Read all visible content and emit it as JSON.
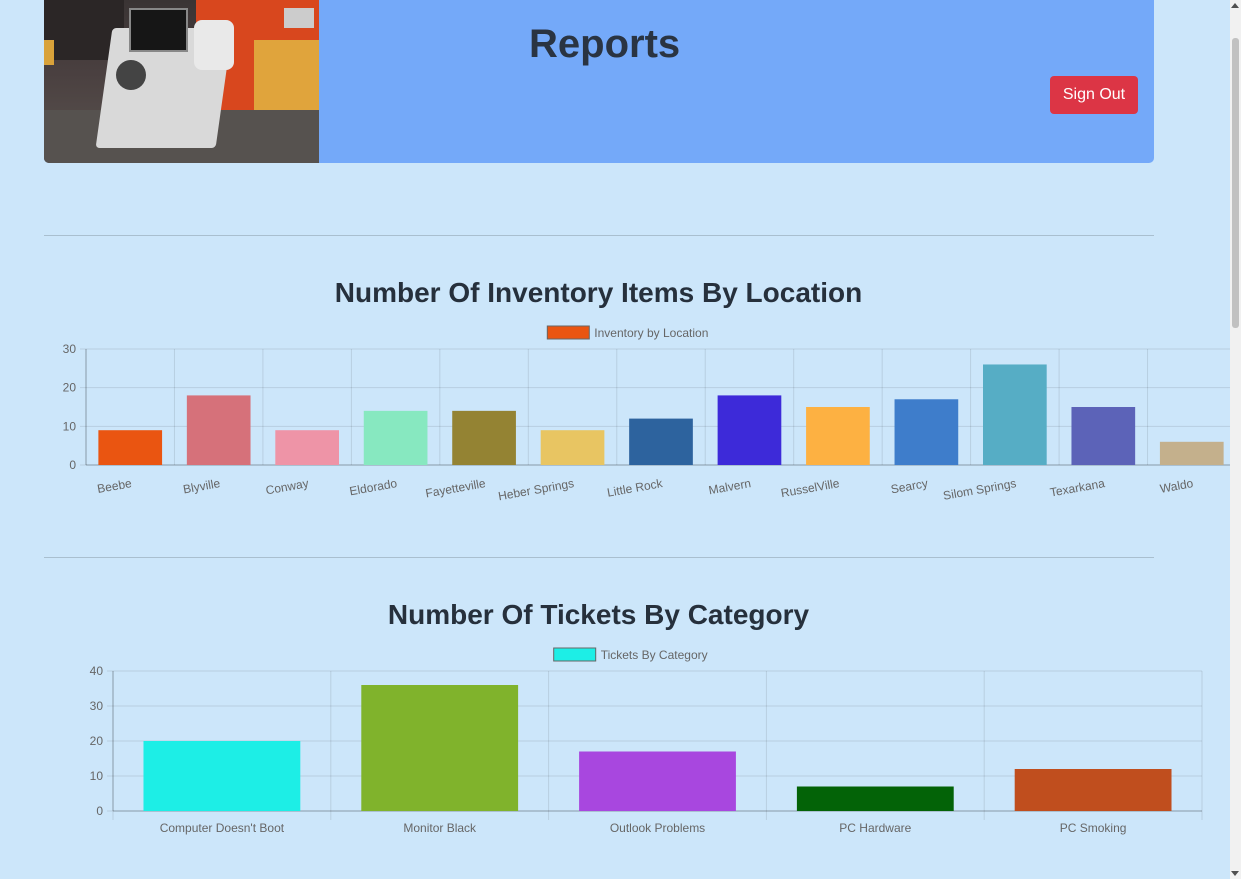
{
  "header": {
    "title": "Reports",
    "sign_out_label": "Sign Out",
    "banner_image": "help-desk-photo"
  },
  "colors": {
    "page_background": "#cce6fa",
    "header_background": "#74a9f9",
    "sign_out_button": "#dc3545"
  },
  "chart_data": [
    {
      "type": "bar",
      "title": "Number Of Inventory Items By Location",
      "categories": [
        "Beebe",
        "Blyville",
        "Conway",
        "Eldorado",
        "Fayetteville",
        "Heber Springs",
        "Little Rock",
        "Malvern",
        "RusselVille",
        "Searcy",
        "Silom Springs",
        "Texarkana",
        "Waldo"
      ],
      "series": [
        {
          "name": "Inventory by Location",
          "values": [
            9,
            18,
            9,
            14,
            14,
            9,
            12,
            18,
            15,
            17,
            26,
            15,
            6
          ]
        }
      ],
      "colors": [
        "#ea5511",
        "#d6717a",
        "#ee94a7",
        "#87e8c0",
        "#948333",
        "#e8c562",
        "#2d639e",
        "#3d2ad9",
        "#fdb142",
        "#3e7dcb",
        "#56adc5",
        "#5c63b8",
        "#c4b08c"
      ],
      "legend_color": "#ea5511",
      "ylim": [
        0,
        30
      ],
      "yticks": [
        0,
        10,
        20,
        30
      ],
      "grid": true,
      "legend": "top"
    },
    {
      "type": "bar",
      "title": "Number Of Tickets By Category",
      "categories": [
        "Computer Doesn't Boot",
        "Monitor Black",
        "Outlook Problems",
        "PC Hardware",
        "PC Smoking"
      ],
      "series": [
        {
          "name": "Tickets By Category",
          "values": [
            20,
            36,
            17,
            7,
            12
          ]
        }
      ],
      "colors": [
        "#1deee6",
        "#80b32c",
        "#a847df",
        "#036307",
        "#c04e1e"
      ],
      "legend_color": "#1deee6",
      "ylim": [
        0,
        40
      ],
      "yticks": [
        0,
        10,
        20,
        30,
        40
      ],
      "grid": true,
      "legend": "top"
    }
  ]
}
